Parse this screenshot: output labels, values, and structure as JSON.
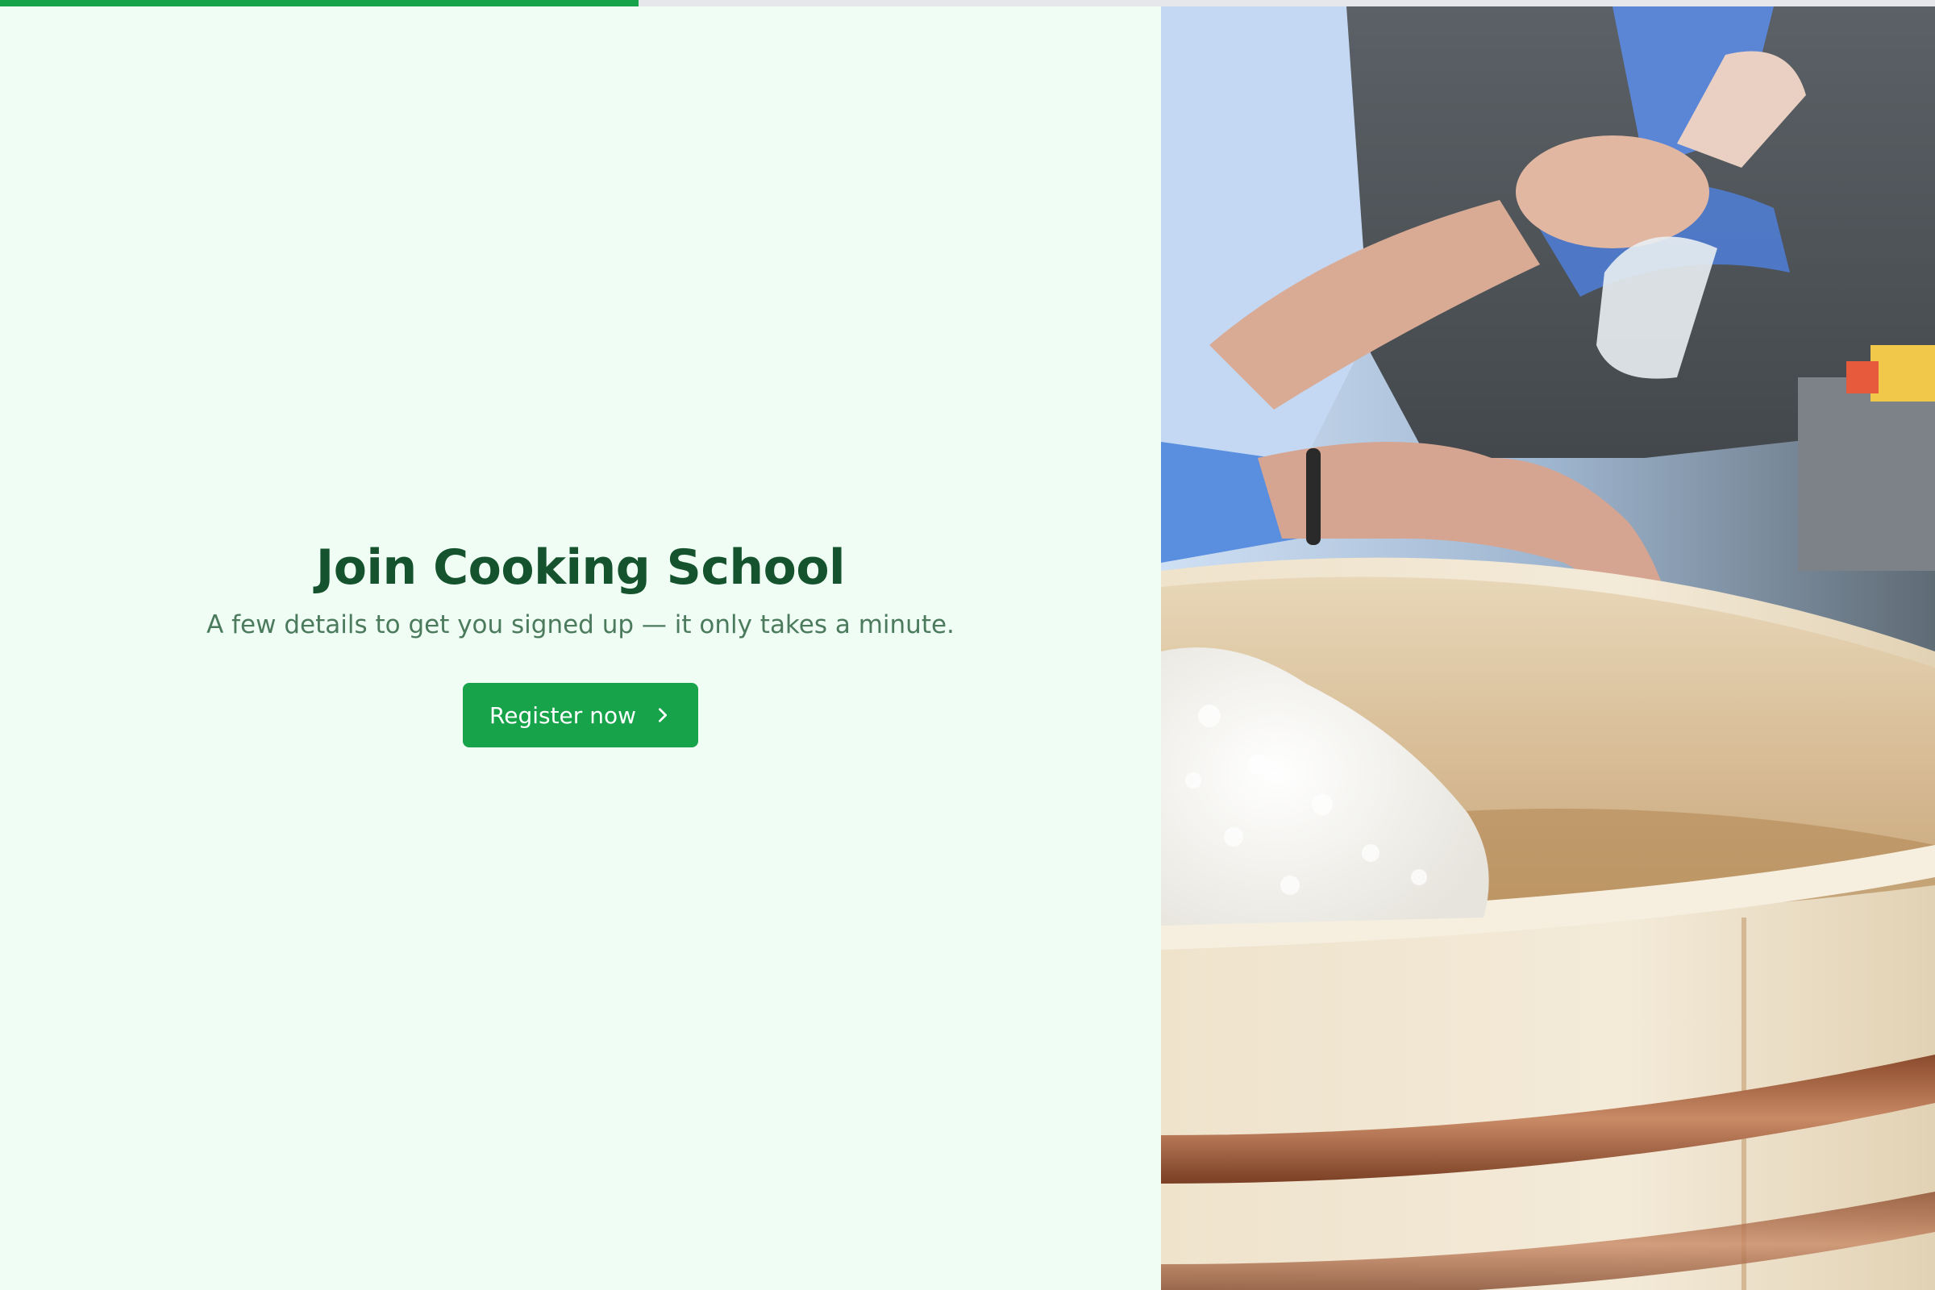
{
  "progress": {
    "value_percent": 33,
    "color": "#16a34a",
    "track_color": "#e5e7eb"
  },
  "hero": {
    "title": "Join Cooking School",
    "subtitle": "A few details to get you signed up — it only takes a minute.",
    "cta_label": "Register now",
    "cta_icon": "chevron-right-icon"
  },
  "colors": {
    "page_background": "#f0fdf4",
    "title": "#14532d",
    "subtitle": "#4b7a5d",
    "accent": "#16a34a"
  },
  "photo": {
    "subject": "hands preparing sushi rice in a wooden hangiri tub"
  }
}
